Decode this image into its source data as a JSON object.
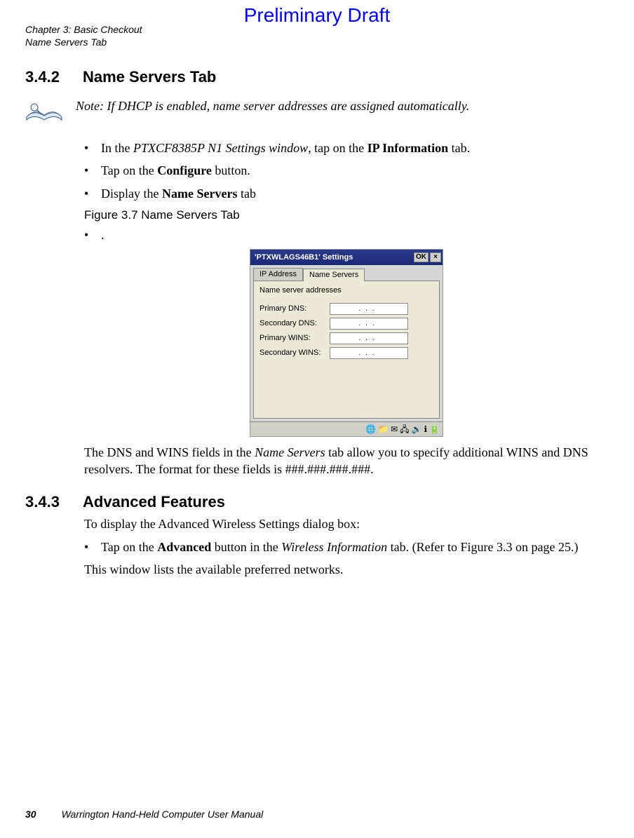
{
  "watermark": "Preliminary Draft",
  "header": {
    "chapter": "Chapter 3: Basic Checkout",
    "section": "Name Servers Tab"
  },
  "sec342": {
    "num": "3.4.2",
    "title": "Name Servers Tab"
  },
  "note": "Note: If DHCP is enabled, name server addresses are assigned automatically.",
  "steps1": {
    "a_pre": "In the ",
    "a_em": "PTXCF8385P N1 Settings window",
    "a_mid": ", tap on the ",
    "a_bold": "IP Information",
    "a_post": " tab.",
    "b_pre": "Tap on the ",
    "b_bold": "Configure",
    "b_post": " button.",
    "c_pre": "Display the ",
    "c_bold": "Name Servers",
    "c_post": " tab"
  },
  "figcap": "Figure 3.7  Name Servers Tab",
  "dotline": ".",
  "window": {
    "title": "'PTXWLAGS46B1' Settings",
    "ok": "OK",
    "close": "×",
    "tab1": "IP Address",
    "tab2": "Name Servers",
    "heading": "Name server addresses",
    "rows": {
      "r0": "Primary DNS:",
      "r1": "Secondary DNS:",
      "r2": "Primary WINS:",
      "r3": "Secondary WINS:"
    },
    "ipdots": "...",
    "tray": {
      "i0": "🌐",
      "i1": "📁",
      "i2": "✉",
      "i3": "🖧",
      "i4": "🔊",
      "i5": "ℹ",
      "i6": "🔋"
    }
  },
  "afterfig": {
    "a_pre": "The DNS and WINS fields in the ",
    "a_em": "Name Servers",
    "a_post": " tab allow you to specify additional WINS and DNS resolvers. The format for these fields is ###.###.###.###."
  },
  "sec343": {
    "num": "3.4.3",
    "title": "Advanced Features"
  },
  "advintro": "To display the Advanced Wireless Settings dialog box:",
  "advstep": {
    "pre": "Tap on the ",
    "bold": "Advanced",
    "mid": " button in the ",
    "em": "Wireless Information",
    "post": " tab. (Refer to Figure 3.3 on page 25.)"
  },
  "advout": "This window lists the available preferred networks.",
  "footer": {
    "page": "30",
    "doc": "Warrington Hand-Held Computer User Manual"
  }
}
